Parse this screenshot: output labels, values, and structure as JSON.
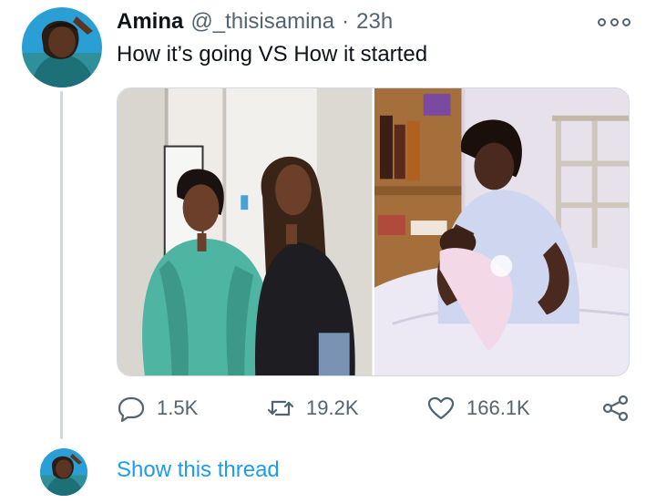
{
  "tweet": {
    "author_name": "Amina",
    "author_handle": "@_thisisamina",
    "separator": "·",
    "time": "23h",
    "text": "How it’s going VS How it started",
    "more_icon": "more-horizontal-icon",
    "media": [
      {
        "name": "photo-how-its-going"
      },
      {
        "name": "photo-how-it-started"
      }
    ],
    "actions": {
      "reply_icon": "reply-icon",
      "reply_count": "1.5K",
      "retweet_icon": "retweet-icon",
      "retweet_count": "19.2K",
      "like_icon": "heart-icon",
      "like_count": "166.1K",
      "share_icon": "share-icon"
    }
  },
  "thread": {
    "show_label": "Show this thread"
  },
  "colors": {
    "link": "#1d9bf0",
    "secondary_text": "#536471",
    "primary_text": "#0f1419",
    "thread_line": "#cfd9de"
  }
}
